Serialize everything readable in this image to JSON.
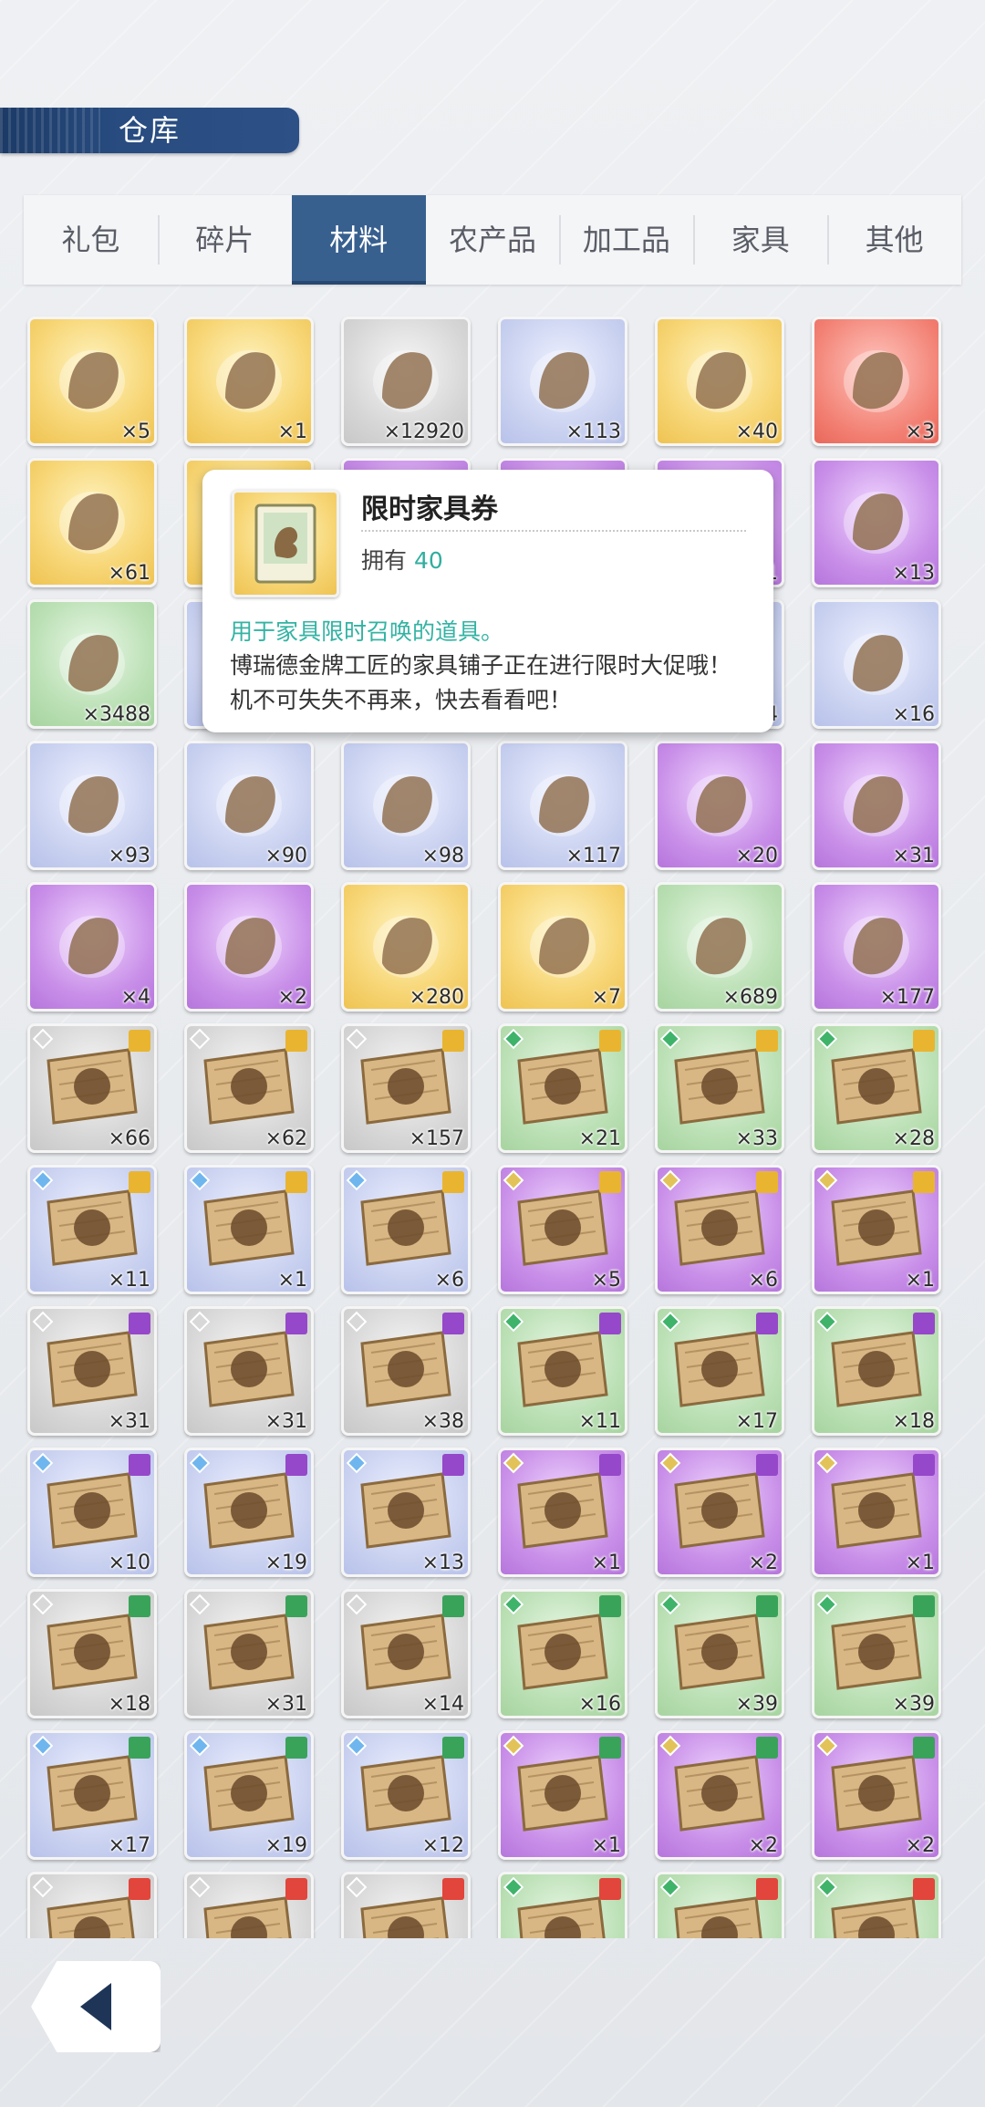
{
  "header": {
    "title": "仓库"
  },
  "tabs": [
    {
      "label": "礼包",
      "active": false
    },
    {
      "label": "碎片",
      "active": false
    },
    {
      "label": "材料",
      "active": true
    },
    {
      "label": "农产品",
      "active": false
    },
    {
      "label": "加工品",
      "active": false
    },
    {
      "label": "家具",
      "active": false
    },
    {
      "label": "其他",
      "active": false
    }
  ],
  "items": [
    {
      "q": "gold",
      "icon": "ticket-icon",
      "count": "×5"
    },
    {
      "q": "gold",
      "icon": "ticket-pink-icon",
      "count": "×1"
    },
    {
      "q": "gray",
      "icon": "medal-icon",
      "count": "×12920"
    },
    {
      "q": "blue",
      "icon": "silver-branch-icon",
      "count": "×113"
    },
    {
      "q": "gold",
      "icon": "ticket-icon",
      "count": "×40"
    },
    {
      "q": "red",
      "icon": "voucher-icon",
      "count": "×3"
    },
    {
      "q": "gold",
      "icon": "potion-flask-icon",
      "count": "×61"
    },
    {
      "q": "gold",
      "icon": "hidden-item",
      "count": ""
    },
    {
      "q": "purple",
      "icon": "hidden-item",
      "count": ""
    },
    {
      "q": "purple",
      "icon": "hidden-item",
      "count": ""
    },
    {
      "q": "purple",
      "icon": "hidden-item",
      "count": "1"
    },
    {
      "q": "purple",
      "icon": "red-card-icon",
      "count": "×13"
    },
    {
      "q": "green",
      "icon": "vial-icon",
      "count": "×3488"
    },
    {
      "q": "blue",
      "icon": "hidden-item",
      "count": ""
    },
    {
      "q": "blue",
      "icon": "hidden-item",
      "count": ""
    },
    {
      "q": "blue",
      "icon": "hidden-item",
      "count": ""
    },
    {
      "q": "blue",
      "icon": "hidden-item",
      "count": "4"
    },
    {
      "q": "blue",
      "icon": "wax-seal-icon",
      "count": "×16"
    },
    {
      "q": "blue",
      "icon": "ore-rock-icon",
      "count": "×93"
    },
    {
      "q": "blue",
      "icon": "jar-icon",
      "count": "×90"
    },
    {
      "q": "blue",
      "icon": "bone-icon",
      "count": "×98"
    },
    {
      "q": "blue",
      "icon": "seed-pod-icon",
      "count": "×117"
    },
    {
      "q": "purple",
      "icon": "amber-icon",
      "count": "×20"
    },
    {
      "q": "purple",
      "icon": "shell-pile-icon",
      "count": "×31"
    },
    {
      "q": "purple",
      "icon": "leaf-pearl-icon",
      "count": "×4"
    },
    {
      "q": "purple",
      "icon": "lightning-icon",
      "count": "×2"
    },
    {
      "q": "gold",
      "icon": "gem-charm-icon",
      "count": "×280"
    },
    {
      "q": "gold",
      "icon": "house-map-icon",
      "count": "×7"
    },
    {
      "q": "green",
      "icon": "dark-ore-icon",
      "count": "×689"
    },
    {
      "q": "purple",
      "icon": "red-crystal-icon",
      "count": "×177"
    },
    {
      "q": "gray",
      "icon": "blueprint-sword-icon",
      "count": "×66",
      "badge": "gold"
    },
    {
      "q": "gray",
      "icon": "blueprint-shield-icon",
      "count": "×62",
      "badge": "gold"
    },
    {
      "q": "gray",
      "icon": "blueprint-totem-icon",
      "count": "×157",
      "badge": "gold"
    },
    {
      "q": "green",
      "icon": "blueprint-sword-icon",
      "count": "×21",
      "badge": "gold"
    },
    {
      "q": "green",
      "icon": "blueprint-shield-icon",
      "count": "×33",
      "badge": "gold"
    },
    {
      "q": "green",
      "icon": "blueprint-totem-icon",
      "count": "×28",
      "badge": "gold"
    },
    {
      "q": "blue",
      "icon": "blueprint-sword-icon",
      "count": "×11",
      "badge": "gold"
    },
    {
      "q": "blue",
      "icon": "blueprint-shield-icon",
      "count": "×1",
      "badge": "gold"
    },
    {
      "q": "blue",
      "icon": "blueprint-totem-icon",
      "count": "×6",
      "badge": "gold"
    },
    {
      "q": "purple",
      "icon": "blueprint-sword-icon",
      "count": "×5",
      "badge": "gold"
    },
    {
      "q": "purple",
      "icon": "blueprint-shield-icon",
      "count": "×6",
      "badge": "gold"
    },
    {
      "q": "purple",
      "icon": "blueprint-totem-icon",
      "count": "×1",
      "badge": "gold"
    },
    {
      "q": "gray",
      "icon": "blueprint-horn-icon",
      "count": "×31",
      "badge": "purple"
    },
    {
      "q": "gray",
      "icon": "blueprint-armor-icon",
      "count": "×31",
      "badge": "purple"
    },
    {
      "q": "gray",
      "icon": "blueprint-amulet-icon",
      "count": "×38",
      "badge": "purple"
    },
    {
      "q": "green",
      "icon": "blueprint-horn-icon",
      "count": "×11",
      "badge": "purple"
    },
    {
      "q": "green",
      "icon": "blueprint-armor-icon",
      "count": "×17",
      "badge": "purple"
    },
    {
      "q": "green",
      "icon": "blueprint-amulet-icon",
      "count": "×18",
      "badge": "purple"
    },
    {
      "q": "blue",
      "icon": "blueprint-horn-icon",
      "count": "×10",
      "badge": "purple"
    },
    {
      "q": "blue",
      "icon": "blueprint-armor-icon",
      "count": "×19",
      "badge": "purple"
    },
    {
      "q": "blue",
      "icon": "blueprint-amulet-icon",
      "count": "×13",
      "badge": "purple"
    },
    {
      "q": "purple",
      "icon": "blueprint-horn-icon",
      "count": "×1",
      "badge": "purple"
    },
    {
      "q": "purple",
      "icon": "blueprint-armor-icon",
      "count": "×2",
      "badge": "purple"
    },
    {
      "q": "purple",
      "icon": "blueprint-amulet-icon",
      "count": "×1",
      "badge": "purple"
    },
    {
      "q": "gray",
      "icon": "blueprint-book-icon",
      "count": "×18",
      "badge": "green"
    },
    {
      "q": "gray",
      "icon": "blueprint-wheel-icon",
      "count": "×31",
      "badge": "green"
    },
    {
      "q": "gray",
      "icon": "blueprint-lantern-icon",
      "count": "×14",
      "badge": "green"
    },
    {
      "q": "green",
      "icon": "blueprint-book-icon",
      "count": "×16",
      "badge": "green"
    },
    {
      "q": "green",
      "icon": "blueprint-wheel-icon",
      "count": "×39",
      "badge": "green"
    },
    {
      "q": "green",
      "icon": "blueprint-lantern-icon",
      "count": "×39",
      "badge": "green"
    },
    {
      "q": "blue",
      "icon": "blueprint-book-icon",
      "count": "×17",
      "badge": "green"
    },
    {
      "q": "blue",
      "icon": "blueprint-wheel-icon",
      "count": "×19",
      "badge": "green"
    },
    {
      "q": "blue",
      "icon": "blueprint-lantern-icon",
      "count": "×12",
      "badge": "green"
    },
    {
      "q": "purple",
      "icon": "blueprint-book-icon",
      "count": "×1",
      "badge": "green"
    },
    {
      "q": "purple",
      "icon": "blueprint-wheel-icon",
      "count": "×2",
      "badge": "green"
    },
    {
      "q": "purple",
      "icon": "blueprint-lantern-icon",
      "count": "×2",
      "badge": "green"
    },
    {
      "q": "gray",
      "icon": "blueprint-dagger-icon",
      "count": "",
      "badge": "red"
    },
    {
      "q": "gray",
      "icon": "blueprint-rope-icon",
      "count": "",
      "badge": "red"
    },
    {
      "q": "gray",
      "icon": "blueprint-pack-icon",
      "count": "",
      "badge": "red"
    },
    {
      "q": "green",
      "icon": "blueprint-dagger-icon",
      "count": "",
      "badge": "red"
    },
    {
      "q": "green",
      "icon": "blueprint-rope-icon",
      "count": "",
      "badge": "red"
    },
    {
      "q": "green",
      "icon": "blueprint-pack-icon",
      "count": "",
      "badge": "red"
    }
  ],
  "tooltip": {
    "name": "限时家具券",
    "own_label": "拥有",
    "own_value": "40",
    "desc_highlight": "用于家具限时召唤的道具。",
    "desc_body": "博瑞德金牌工匠的家具铺子正在进行限时大促哦！机不可失失不再来，快去看看吧！"
  },
  "colors": {
    "accent": "#38608f",
    "title_bar": "#284c80",
    "highlight_text": "#33b3a3"
  },
  "back_button": {
    "icon": "back-arrow-icon"
  }
}
